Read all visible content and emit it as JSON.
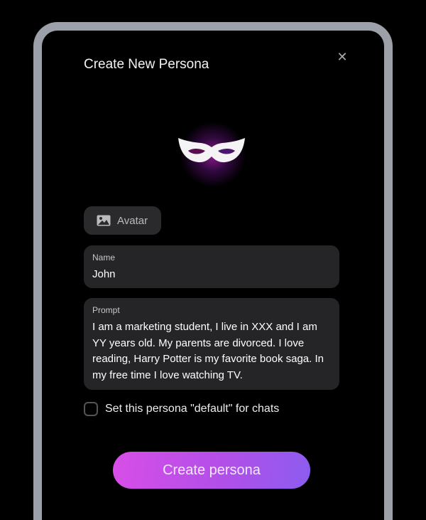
{
  "dialog": {
    "title": "Create New Persona",
    "close_icon": "close-icon"
  },
  "avatar": {
    "label": "Avatar",
    "icon": "image-icon"
  },
  "name_field": {
    "label": "Name",
    "value": "John"
  },
  "prompt_field": {
    "label": "Prompt",
    "value": "I am a marketing student, I live in XXX and I am YY years old. My parents are divorced. I love reading, Harry Potter is my favorite book saga. In my free time I love watching TV."
  },
  "default_checkbox": {
    "label": "Set this persona \"default\" for chats",
    "checked": false
  },
  "submit": {
    "label": "Create persona"
  },
  "colors": {
    "accent_start": "#d94ee8",
    "accent_end": "#8c5cf0",
    "frame": "#9ca1a9"
  }
}
